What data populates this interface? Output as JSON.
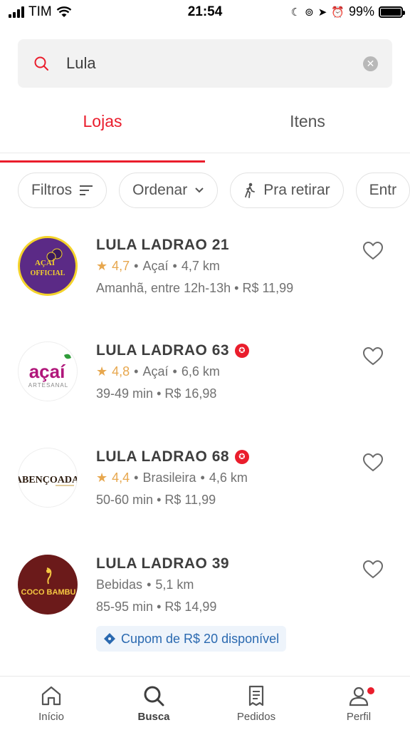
{
  "status_bar": {
    "carrier": "TIM",
    "time": "21:54",
    "battery": "99%",
    "battery_level": 0.99
  },
  "search": {
    "query": "Lula",
    "placeholder": ""
  },
  "tabs": [
    {
      "label": "Lojas",
      "active": true
    },
    {
      "label": "Itens",
      "active": false
    }
  ],
  "filters": [
    {
      "label": "Filtros",
      "icon": "filter-lines-icon"
    },
    {
      "label": "Ordenar",
      "icon": "chevron-down-icon"
    },
    {
      "label": "Pra retirar",
      "icon": "walking-person-icon"
    },
    {
      "label": "Entr",
      "icon": ""
    }
  ],
  "stores": [
    {
      "name": "LULA LADRAO 21",
      "super": false,
      "rating": "4,7",
      "category": "Açaí",
      "distance": "4,7 km",
      "delivery_time": "Amanhã, entre 12h-13h",
      "fee": "R$ 11,99",
      "logo": {
        "line1": "AÇAÍ",
        "line2": "OFFICIAL",
        "bg": "#5b2a86",
        "fg": "#f4d32b"
      }
    },
    {
      "name": "LULA LADRAO 63",
      "super": true,
      "rating": "4,8",
      "category": "Açaí",
      "distance": "6,6 km",
      "delivery_time": "39-49 min",
      "fee": "R$ 16,98",
      "logo": {
        "line1": "açaí",
        "line2": "ARTESANAL",
        "bg": "#ffffff",
        "fg": "#b0167a"
      }
    },
    {
      "name": "LULA LADRAO 68",
      "super": true,
      "rating": "4,4",
      "category": "Brasileira",
      "distance": "4,6 km",
      "delivery_time": "50-60 min",
      "fee": "R$ 11,99",
      "logo": {
        "line1": "ABENÇOADA",
        "line2": "",
        "bg": "#ffffff",
        "fg": "#2b1a0d"
      }
    },
    {
      "name": "LULA LADRAO 39",
      "super": false,
      "rating": "",
      "category": "Bebidas",
      "distance": "5,1 km",
      "delivery_time": "85-95 min",
      "fee": "R$ 14,99",
      "coupon": "Cupom de R$ 20 disponível",
      "logo": {
        "line1": "COCO BAMBU",
        "line2": "",
        "bg": "#6b1a1a",
        "fg": "#f5c842"
      }
    }
  ],
  "bottom_nav": [
    {
      "label": "Início",
      "icon": "home-icon",
      "active": false
    },
    {
      "label": "Busca",
      "icon": "search-icon",
      "active": true
    },
    {
      "label": "Pedidos",
      "icon": "orders-icon",
      "active": false
    },
    {
      "label": "Perfil",
      "icon": "profile-icon",
      "active": false,
      "notification": true
    }
  ],
  "colors": {
    "accent": "#ea1d2c",
    "rating": "#e7a74e",
    "coupon_text": "#2a69b0",
    "coupon_bg": "#eef4fb"
  }
}
